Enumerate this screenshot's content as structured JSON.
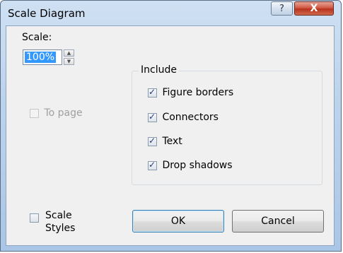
{
  "window": {
    "title": "Scale Diagram",
    "help_label": "?",
    "close_label": "X"
  },
  "scale": {
    "label": "Scale:",
    "value": "100%",
    "to_page_label": "To page",
    "to_page_checked": false,
    "to_page_enabled": false
  },
  "include": {
    "legend": "Include",
    "items": [
      {
        "label": "Figure borders",
        "checked": true
      },
      {
        "label": "Connectors",
        "checked": true
      },
      {
        "label": "Text",
        "checked": true
      },
      {
        "label": "Drop shadows",
        "checked": true
      }
    ]
  },
  "scale_styles": {
    "line1": "Scale",
    "line2": "Styles",
    "checked": false
  },
  "buttons": {
    "ok_label": "OK",
    "cancel_label": "Cancel"
  }
}
